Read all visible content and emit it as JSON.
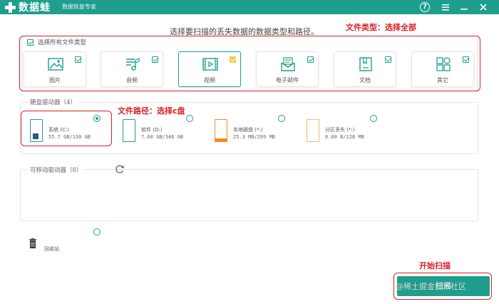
{
  "titlebar": {
    "app_name": "数据蛙",
    "subtitle": "数据恢复专家",
    "help_icon": "help-circle-icon",
    "menu_icon": "menu-icon",
    "minimize_icon": "minimize-icon",
    "close_icon": "close-icon",
    "color": "#1f9e8e"
  },
  "prompt": "选择要扫描的丢失数据的数据类型和路径。",
  "file_types": {
    "select_all_label": "选择所有文件类型",
    "select_all_checked": true,
    "items": [
      {
        "label": "图片",
        "icon": "image-icon",
        "checked": true,
        "selected": false
      },
      {
        "label": "音频",
        "icon": "audio-icon",
        "checked": true,
        "selected": false
      },
      {
        "label": "视频",
        "icon": "video-icon",
        "checked": true,
        "selected": true
      },
      {
        "label": "电子邮件",
        "icon": "email-icon",
        "checked": true,
        "selected": false
      },
      {
        "label": "文档",
        "icon": "document-icon",
        "checked": true,
        "selected": false
      },
      {
        "label": "其它",
        "icon": "other-icon",
        "checked": true,
        "selected": false
      }
    ]
  },
  "disks": {
    "title": "硬盘驱动器（4）",
    "items": [
      {
        "name": "系统 (C:)",
        "size": "55.7 GB/130 GB",
        "selected": true
      },
      {
        "name": "软件 (D:)",
        "size": "7.68 GB/346 GB",
        "selected": false
      },
      {
        "name": "本地磁盘 (*:)",
        "size": "25.3 MB/299 MB",
        "selected": false
      },
      {
        "name": "分区丢失 (*:)",
        "size": "0.00  B/128 MB",
        "selected": false
      }
    ]
  },
  "removable": {
    "title": "可移动驱动器（0）",
    "refresh_icon": "refresh-icon"
  },
  "recycle_bin": {
    "label": "回收站",
    "icon": "trash-icon"
  },
  "start_button": {
    "label": "扫描"
  },
  "annotations": {
    "file_type": "文件类型：选择全部",
    "file_path": "文件路径：选择c盘",
    "start_scan": "开始扫描",
    "color": "#d9222a"
  },
  "watermark": "@稀土掘金技术社区"
}
